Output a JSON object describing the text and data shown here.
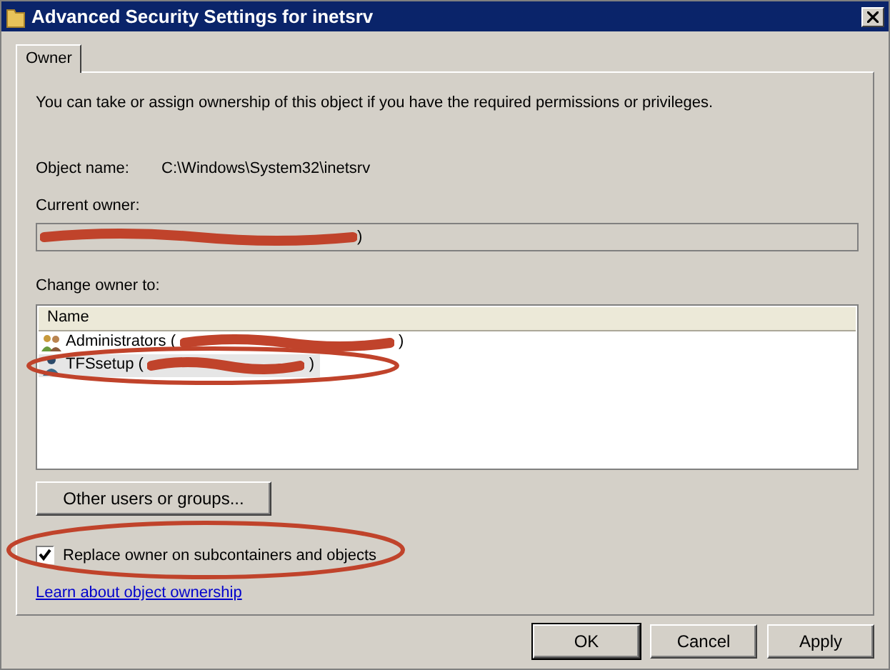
{
  "window": {
    "title": "Advanced Security Settings for inetsrv"
  },
  "tabs": [
    {
      "label": "Owner",
      "selected": true
    }
  ],
  "intro": "You can take or assign ownership of this object if you have the required permissions or privileges.",
  "object_name": {
    "label": "Object name:",
    "value": "C:\\Windows\\System32\\inetsrv"
  },
  "current_owner": {
    "label": "Current owner:",
    "suffix": ")"
  },
  "change_owner": {
    "label": "Change owner to:",
    "column": "Name",
    "rows": [
      {
        "name": "Administrators (",
        "suffix": ")",
        "kind": "group",
        "selected": false
      },
      {
        "name": "TFSsetup (",
        "suffix": ")",
        "kind": "user",
        "selected": true
      }
    ]
  },
  "other_button": "Other users or groups...",
  "replace_owner": {
    "label": "Replace owner on subcontainers and objects",
    "checked": true
  },
  "link": "Learn about object ownership",
  "buttons": [
    {
      "label": "OK",
      "default": true
    },
    {
      "label": "Cancel",
      "default": false
    },
    {
      "label": "Apply",
      "default": false
    }
  ]
}
